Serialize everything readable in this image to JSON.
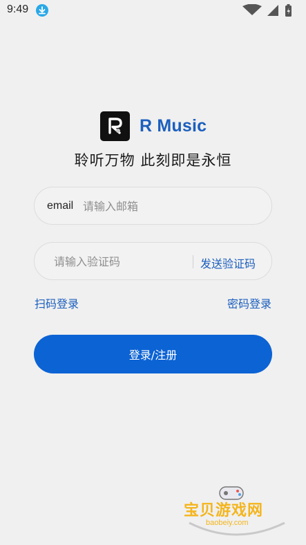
{
  "status_bar": {
    "time": "9:49"
  },
  "app": {
    "name": "R Music",
    "slogan": "聆听万物 此刻即是永恒",
    "logo_letter": "R"
  },
  "email_field": {
    "prefix": "email",
    "placeholder": "请输入邮箱",
    "value": ""
  },
  "code_field": {
    "placeholder": "请输入验证码",
    "value": "",
    "send_label": "发送验证码"
  },
  "links": {
    "qr_login": "扫码登录",
    "password_login": "密码登录"
  },
  "submit": {
    "label": "登录/注册"
  },
  "watermark": {
    "title": "宝贝游戏网",
    "url": "baobeiy.com"
  },
  "colors": {
    "accent": "#1c5fbe",
    "button": "#0c63d4",
    "background": "#f0f0f0"
  }
}
